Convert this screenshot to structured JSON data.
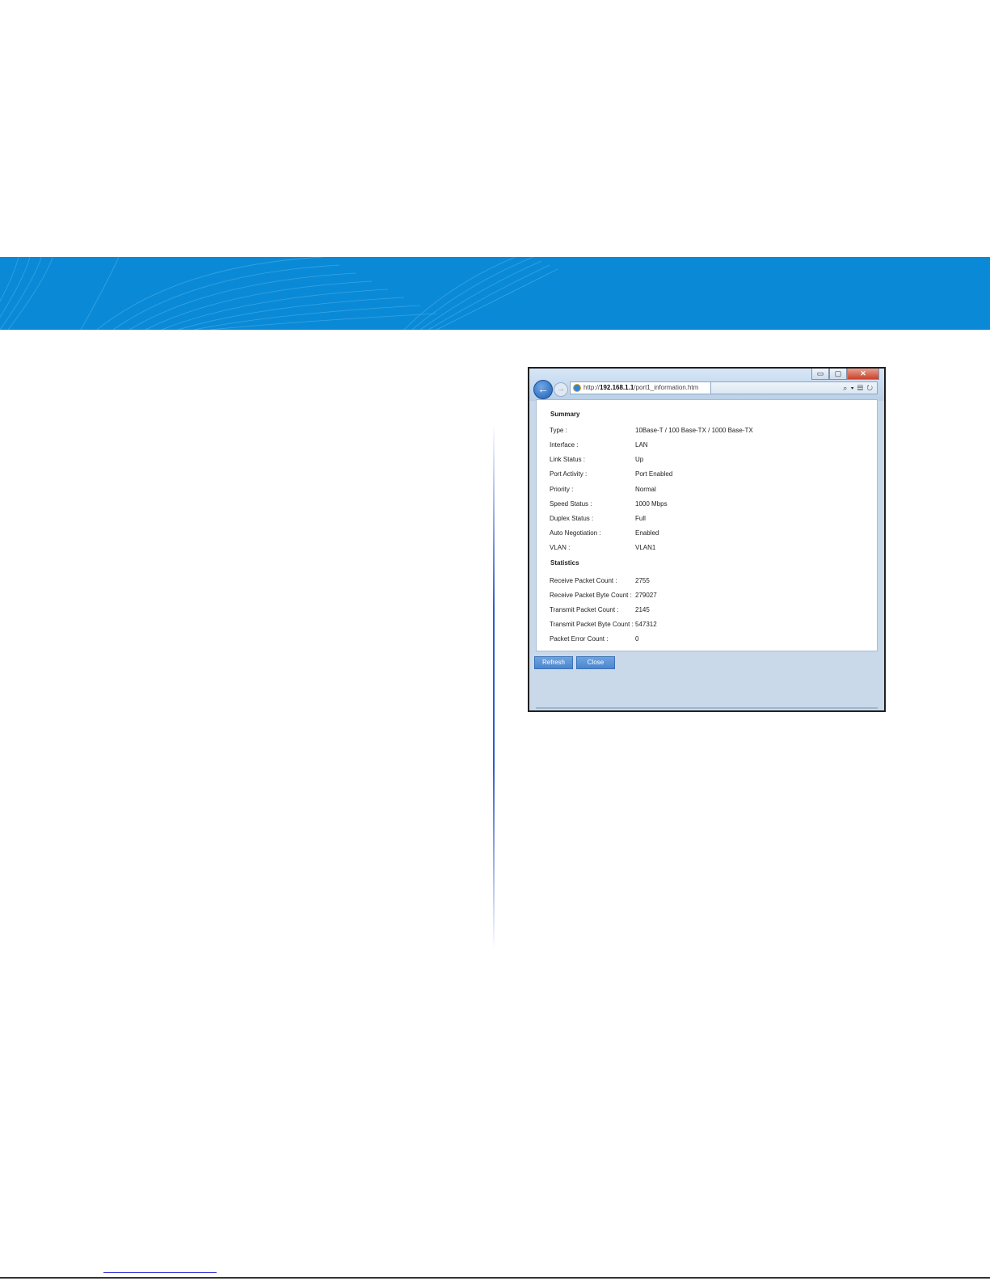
{
  "window": {
    "url_scheme": "http://",
    "url_host": "192.168.1.1",
    "url_path": "/port1_information.htm",
    "controls": {
      "minimize": "▭",
      "maximize": "▢",
      "close": "✕"
    },
    "toolbar_glyphs": "⌕ ▾ ▤ ↻"
  },
  "summary": {
    "title": "Summary",
    "rows": [
      {
        "label": "Type :",
        "value": "10Base-T / 100 Base-TX / 1000 Base-TX"
      },
      {
        "label": "Interface :",
        "value": "LAN"
      },
      {
        "label": "Link Status :",
        "value": "Up"
      },
      {
        "label": "Port Activity :",
        "value": "Port Enabled"
      },
      {
        "label": "Priority :",
        "value": "Normal"
      },
      {
        "label": "Speed Status :",
        "value": "1000 Mbps"
      },
      {
        "label": "Duplex Status :",
        "value": "Full"
      },
      {
        "label": "Auto Negotiation :",
        "value": "Enabled"
      },
      {
        "label": "VLAN :",
        "value": "VLAN1"
      }
    ]
  },
  "statistics": {
    "title": "Statistics",
    "rows": [
      {
        "label": "Receive Packet Count :",
        "value": "2755"
      },
      {
        "label": "Receive Packet Byte Count :",
        "value": "279027"
      },
      {
        "label": "Transmit Packet Count :",
        "value": "2145"
      },
      {
        "label": "Transmit Packet Byte Count :",
        "value": "547312"
      },
      {
        "label": "Packet Error Count :",
        "value": "0"
      }
    ]
  },
  "buttons": {
    "refresh": "Refresh",
    "close": "Close"
  },
  "colors": {
    "banner": "#0a8ad6",
    "button": "#4a86cf"
  },
  "icons": {
    "back": "back-arrow-icon",
    "forward": "forward-arrow-icon",
    "browser": "ie-icon",
    "search": "search-icon",
    "refresh": "refresh-icon"
  }
}
